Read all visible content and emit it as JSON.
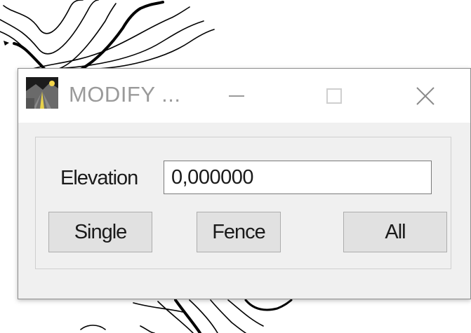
{
  "window": {
    "title": "MODIFY ...",
    "icons": {
      "app": "app-icon",
      "minimize": "minimize-icon",
      "maximize": "maximize-icon",
      "close": "close-icon"
    }
  },
  "form": {
    "elevation_label": "Elevation",
    "elevation_value": "0,000000"
  },
  "buttons": {
    "single": "Single",
    "fence": "Fence",
    "all": "All"
  }
}
